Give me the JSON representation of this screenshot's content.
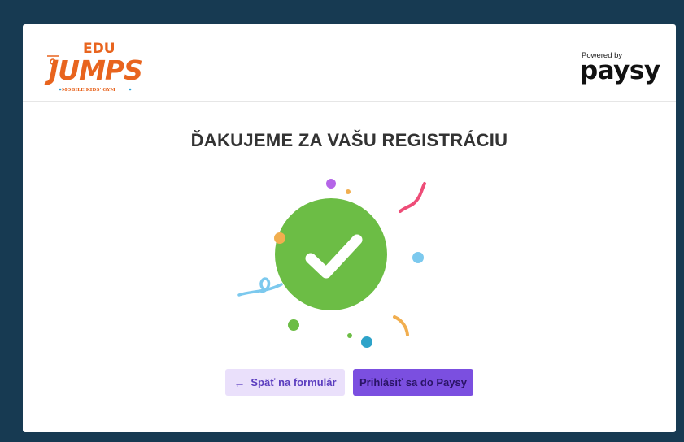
{
  "brand": {
    "logo_top": "EDU",
    "logo_main": "JUMPS",
    "logo_tagline": "MOBILE KIDS' GYM",
    "logo_color": "#e8641e"
  },
  "powered": {
    "label": "Powered by",
    "name": "paysy"
  },
  "page": {
    "title": "ĎAKUJEME ZA VAŠU REGISTRÁCIU"
  },
  "illustration": {
    "check_color": "#6cbd45",
    "icon": "check-icon"
  },
  "actions": {
    "back_icon": "←",
    "back_label": "Späť na formulár",
    "login_label": "Prihlásiť sa do Paysy"
  },
  "colors": {
    "background": "#173a52",
    "primary": "#7b4fe0",
    "secondary": "#eae0fb"
  }
}
